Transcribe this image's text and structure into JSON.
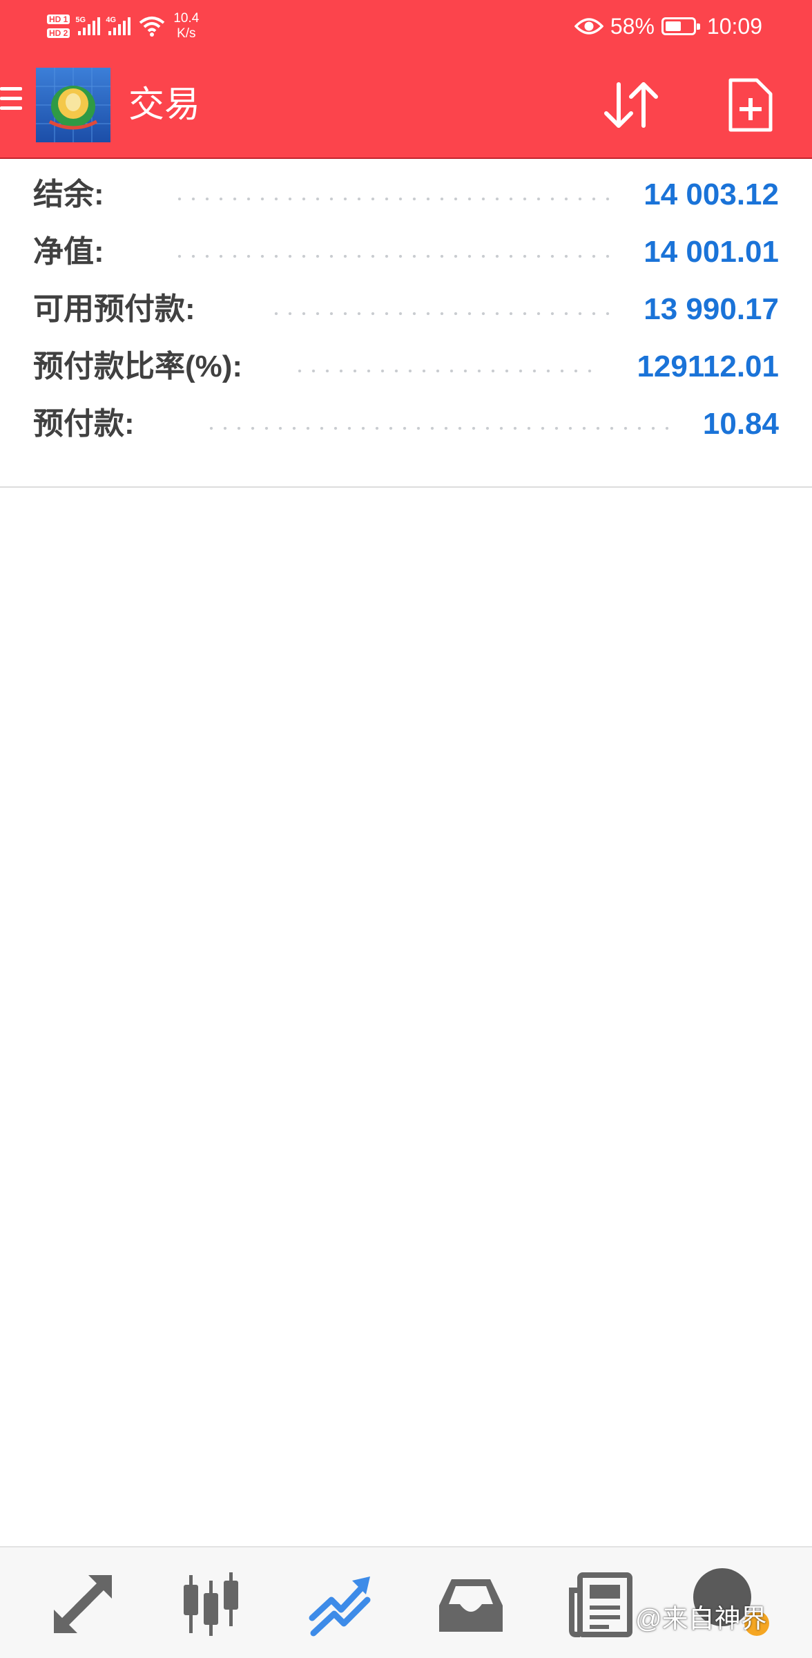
{
  "status_bar": {
    "sim1": "HD 1",
    "sim2": "HD 2",
    "net1": "5G",
    "net2": "4G",
    "speed_value": "10.4",
    "speed_unit": "K/s",
    "battery_percent": "58%",
    "battery_level": 0.58,
    "time": "10:09"
  },
  "app_bar": {
    "title": "交易",
    "icons": [
      "menu-icon",
      "app-logo",
      "sort-icon",
      "new-order-icon"
    ],
    "color": "#fc444c"
  },
  "account": {
    "rows": [
      {
        "label": "结余:",
        "value": "14 003.12"
      },
      {
        "label": "净值:",
        "value": "14 001.01"
      },
      {
        "label": "可用预付款:",
        "value": "13 990.17"
      },
      {
        "label": "预付款比率(%):",
        "value": "129112.01"
      },
      {
        "label": "预付款:",
        "value": "10.84"
      }
    ],
    "value_color": "#1a73d8"
  },
  "bottom_nav": {
    "items": [
      {
        "name": "quotes",
        "icon": "arrows-diagonal-icon"
      },
      {
        "name": "chart",
        "icon": "candlestick-icon"
      },
      {
        "name": "trade",
        "icon": "trend-icon",
        "active": true
      },
      {
        "name": "history",
        "icon": "inbox-icon"
      },
      {
        "name": "news",
        "icon": "newspaper-icon"
      },
      {
        "name": "messages",
        "icon": "chat-icon"
      }
    ],
    "active_color": "#3d8be8"
  },
  "watermark": "@来自神界"
}
